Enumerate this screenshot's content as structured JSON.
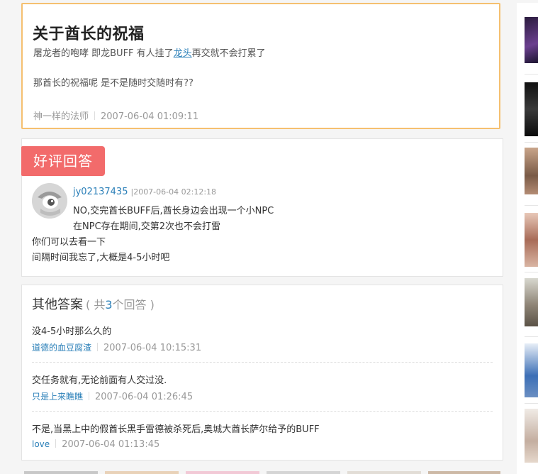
{
  "question": {
    "title": "关于酋长的祝福",
    "line1_prefix": "屠龙者的咆哮 即龙BUFF   有人挂了",
    "line1_link": "龙头",
    "line1_suffix": "再交就不会打累了",
    "line2": "那酋长的祝福呢   是不是随时交随时有??",
    "author": "神一样的法师",
    "time": "2007-06-04 01:09:11"
  },
  "best_answer": {
    "badge": "好评回答",
    "user": "jy02137435",
    "time": "|2007-06-04 02:12:18",
    "lines": [
      "NO,交完酋长BUFF后,酋长身边会出现一个小NPC",
      "在NPC存在期间,交第2次也不会打雷",
      "你们可以去看一下",
      "间隔时间我忘了,大概是4-5小时吧"
    ]
  },
  "other_answers": {
    "title": "其他答案",
    "count_prefix": "( 共",
    "count": "3",
    "count_suffix": "个回答 )",
    "items": [
      {
        "text": "没4-5小时那么久的",
        "user": "道德的血豆腐渣",
        "time": "2007-06-04 10:15:31"
      },
      {
        "text": "交任务就有,无论前面有人交过没.",
        "user": "只是上来瞧瞧",
        "time": "2007-06-04 01:26:45"
      },
      {
        "text": "不是,当黑上中的假酋长黑手雷德被杀死后,奥城大酋长萨尔给予的BUFF",
        "user": "love",
        "time": "2007-06-04 01:13:45"
      }
    ]
  },
  "colors": {
    "accent_border": "#f5c070",
    "badge_bg": "#f26b6b",
    "link": "#2a7fb8"
  }
}
